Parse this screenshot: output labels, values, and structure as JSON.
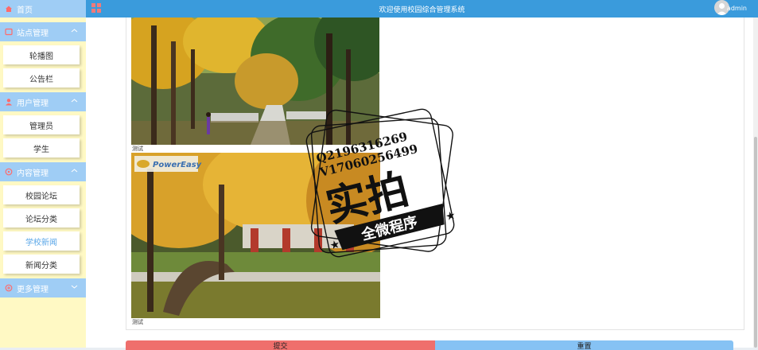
{
  "sidebar": {
    "home_label": "首页",
    "groups": [
      {
        "label": "站点管理",
        "items": [
          "轮播图",
          "公告栏"
        ]
      },
      {
        "label": "用户管理",
        "items": [
          "管理员",
          "学生"
        ]
      },
      {
        "label": "内容管理",
        "items": [
          "校园论坛",
          "论坛分类",
          "学校新闻",
          "新闻分类"
        ]
      },
      {
        "label": "更多管理",
        "items": []
      }
    ],
    "active_item": "学校新闻"
  },
  "topbar": {
    "title": "欢迎使用校园综合管理系统",
    "username": "admin"
  },
  "content": {
    "captions": [
      "测试",
      "测试"
    ],
    "photo_logo": "PowerEasy"
  },
  "buttons": {
    "submit": "提交",
    "reset": "重置"
  },
  "watermark": {
    "line1": "Q2196316269",
    "line2": "V17060256499",
    "main": "实拍",
    "banner": "全微程序"
  },
  "colors": {
    "sidebar_bg": "#fff9c4",
    "menu_bar": "#9fcdf5",
    "topbar": "#3a9bdc",
    "submit": "#ef6f6c",
    "reset": "#86c2f4",
    "active_item": "#5aa7e8"
  }
}
